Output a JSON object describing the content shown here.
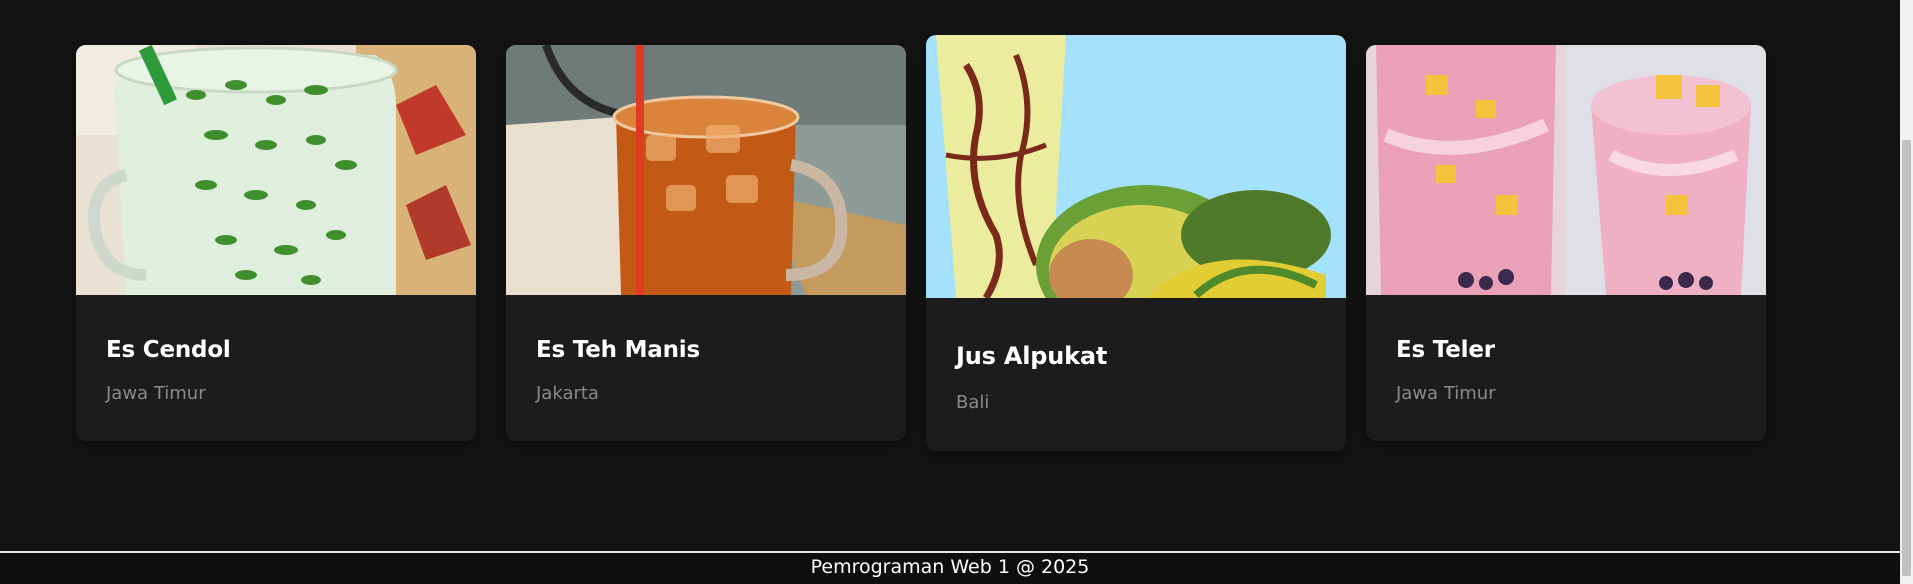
{
  "cards": [
    {
      "title": "Es Cendol",
      "region": "Jawa Timur",
      "image_icon": "es-cendol-image"
    },
    {
      "title": "Es Teh Manis",
      "region": "Jakarta",
      "image_icon": "es-teh-manis-image"
    },
    {
      "title": "Jus Alpukat",
      "region": "Bali",
      "image_icon": "jus-alpukat-image"
    },
    {
      "title": "Es Teler",
      "region": "Jawa Timur",
      "image_icon": "es-teler-image"
    }
  ],
  "footer": {
    "text": "Pemrograman Web 1 @ 2025"
  },
  "colors": {
    "background": "#131313",
    "card": "#1c1c1c",
    "title": "#ffffff",
    "subtitle": "#8a8a8a",
    "footer_border": "#e6e6e6"
  }
}
